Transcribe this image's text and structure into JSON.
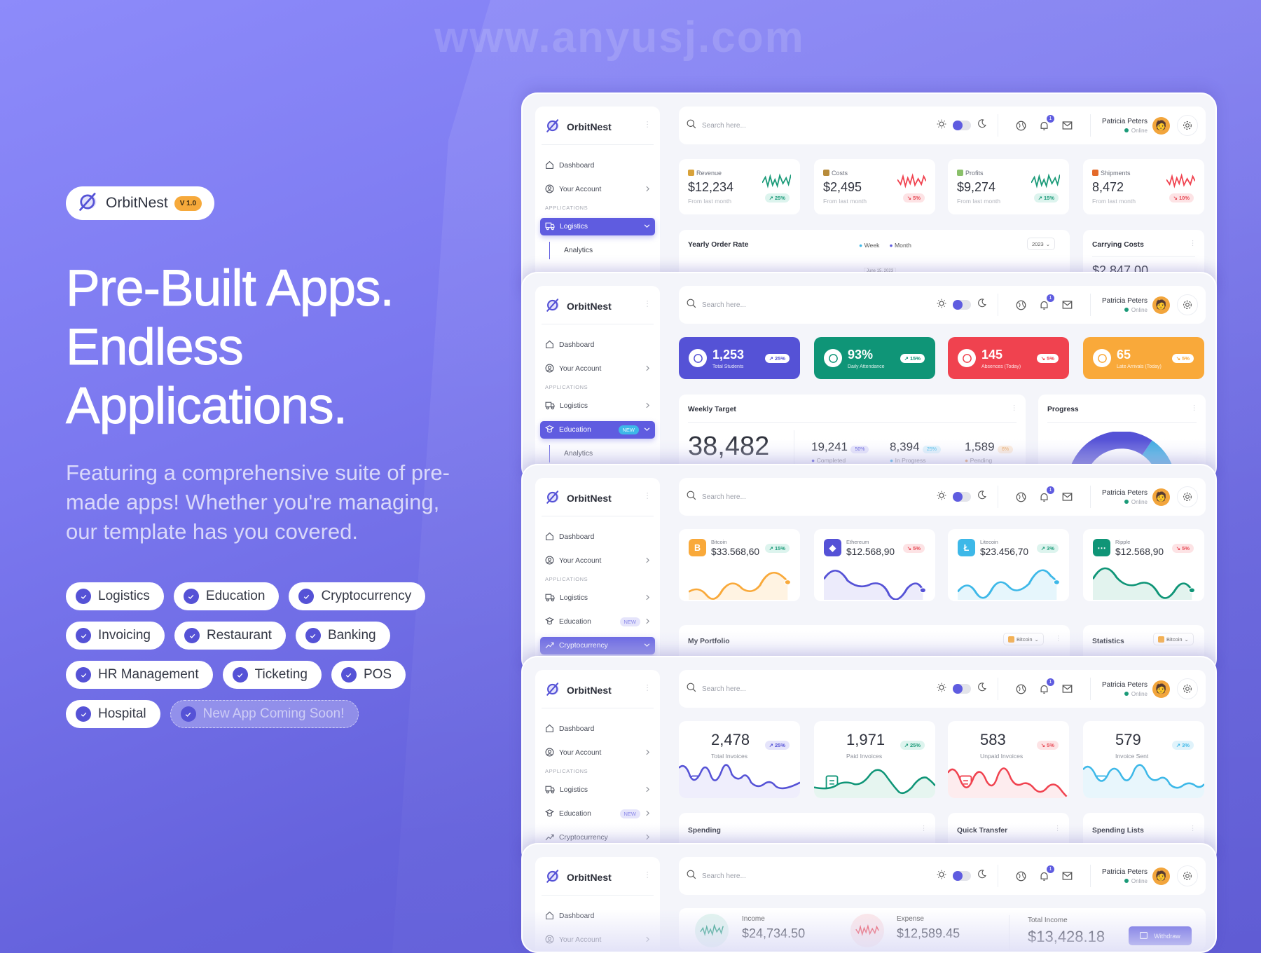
{
  "brand": {
    "name": "OrbitNest",
    "version": "V 1.0"
  },
  "watermark": "www.anyusj.com",
  "hero": {
    "headline": [
      "Pre-Built Apps.",
      "Endless",
      "Applications."
    ],
    "subtitle_lines": [
      "Featuring a comprehensive suite of pre-",
      "made apps!  Whether you're managing,",
      "our template has you covered."
    ],
    "apps": [
      "Logistics",
      "Education",
      "Cryptocurrency",
      "Invoicing",
      "Restaurant",
      "Banking",
      "HR Management",
      "Ticketing",
      "POS",
      "Hospital"
    ],
    "coming_soon": "New App Coming Soon!"
  },
  "colors": {
    "primary": "#5f5ce0",
    "success": "#1a9a78",
    "danger": "#f0424f",
    "warning": "#f9a93a",
    "info": "#3db8e8"
  },
  "header": {
    "search_placeholder": "Search here...",
    "user_name": "Patricia Peters",
    "user_status": "Online",
    "notification_count": "1"
  },
  "sidebar": {
    "section_label": "APPLICATIONS",
    "dashboard": "Dashboard",
    "account": "Your Account",
    "logistics": "Logistics",
    "education": "Education",
    "crypto": "Cryptocurrency",
    "new_badge": "NEW",
    "analytics": "Analytics"
  },
  "logistics": {
    "stats": [
      {
        "label": "Revenue",
        "value": "$12,234",
        "note": "From last month",
        "change": "25%",
        "trend": "up"
      },
      {
        "label": "Costs",
        "value": "$2,495",
        "note": "From last month",
        "change": "5%",
        "trend": "down"
      },
      {
        "label": "Profits",
        "value": "$9,274",
        "note": "From last month",
        "change": "15%",
        "trend": "up"
      },
      {
        "label": "Shipments",
        "value": "8,472",
        "note": "From last month",
        "change": "10%",
        "trend": "down"
      }
    ],
    "order_rate": {
      "title": "Yearly Order Rate",
      "legend": [
        "Week",
        "Month"
      ],
      "year": "2023",
      "tooltip": "June 15, 2023"
    },
    "carrying": {
      "title": "Carrying Costs",
      "value": "$2,847.00"
    }
  },
  "education": {
    "stats": [
      {
        "value": "1,253",
        "label": "Total Students",
        "change": "25%",
        "trend": "up"
      },
      {
        "value": "93%",
        "label": "Daily Attendance",
        "change": "15%",
        "trend": "up"
      },
      {
        "value": "145",
        "label": "Absences (Today)",
        "change": "5%",
        "trend": "down"
      },
      {
        "value": "65",
        "label": "Late Arrivals (Today)",
        "change": "5%",
        "trend": "down"
      }
    ],
    "weekly": {
      "title": "Weekly Target",
      "total": "38,482",
      "items": [
        {
          "value": "19,241",
          "pct": "50%",
          "label": "Completed"
        },
        {
          "value": "8,394",
          "pct": "25%",
          "label": "In Progress"
        },
        {
          "value": "1,589",
          "pct": "6%",
          "label": "Pending"
        }
      ]
    },
    "progress": {
      "title": "Progress"
    }
  },
  "crypto": {
    "stats": [
      {
        "name": "Bitcoin",
        "value": "$33.568,60",
        "change": "15%",
        "trend": "up"
      },
      {
        "name": "Ethereum",
        "value": "$12.568,90",
        "change": "5%",
        "trend": "down"
      },
      {
        "name": "Litecoin",
        "value": "$23.456,70",
        "change": "3%",
        "trend": "up"
      },
      {
        "name": "Ripple",
        "value": "$12.568,90",
        "change": "5%",
        "trend": "down"
      }
    ],
    "portfolio": {
      "title": "My Portfolio",
      "select": "Bitcoin"
    },
    "statistics": {
      "title": "Statistics",
      "select": "Bitcoin"
    }
  },
  "invoicing": {
    "stats": [
      {
        "value": "2,478",
        "label": "Total Invoices",
        "change": "25%",
        "trend": "up"
      },
      {
        "value": "1,971",
        "label": "Paid Invoices",
        "change": "25%",
        "trend": "up"
      },
      {
        "value": "583",
        "label": "Unpaid Invoices",
        "change": "5%",
        "trend": "down"
      },
      {
        "value": "579",
        "label": "Invoice Sent",
        "change": "3%",
        "trend": "up"
      }
    ],
    "cards": [
      "Spending",
      "Quick Transfer",
      "Spending Lists"
    ]
  },
  "banking": {
    "income": {
      "label": "Income",
      "value": "$24,734.50"
    },
    "expense": {
      "label": "Expense",
      "value": "$12,589.45"
    },
    "total": {
      "label": "Total Income",
      "value": "$13,428.18"
    },
    "withdraw": "Withdraw"
  }
}
